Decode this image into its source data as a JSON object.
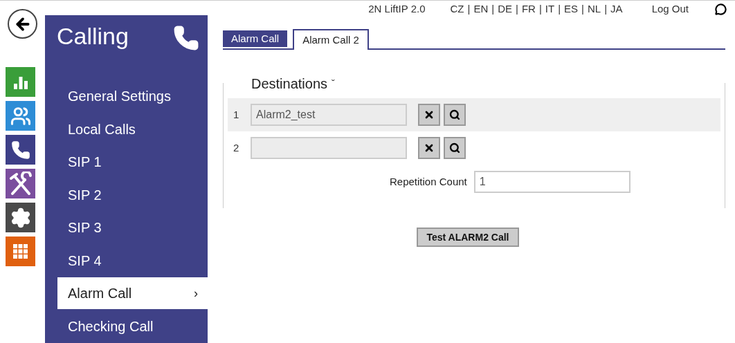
{
  "top_bar": {
    "device": "2N LiftIP 2.0",
    "languages": [
      "CZ",
      "EN",
      "DE",
      "FR",
      "IT",
      "ES",
      "NL",
      "JA"
    ],
    "separator": "|",
    "logout": "Log Out"
  },
  "app_icons": [
    {
      "kind": "chart",
      "color": "#3a9e3a"
    },
    {
      "kind": "users",
      "color": "#2d8dd6"
    },
    {
      "kind": "phone",
      "color": "#3d3f87"
    },
    {
      "kind": "tools",
      "color": "#7b4e9e"
    },
    {
      "kind": "gear",
      "color": "#4a4a4a"
    },
    {
      "kind": "grid",
      "color": "#e0600f"
    }
  ],
  "sidebar": {
    "title": "Calling",
    "items": [
      {
        "label": "General Settings",
        "selected": false
      },
      {
        "label": "Local Calls",
        "selected": false
      },
      {
        "label": "SIP 1",
        "selected": false
      },
      {
        "label": "SIP 2",
        "selected": false
      },
      {
        "label": "SIP 3",
        "selected": false
      },
      {
        "label": "SIP 4",
        "selected": false
      },
      {
        "label": "Alarm Call",
        "selected": true,
        "chevron": "›"
      },
      {
        "label": "Checking Call",
        "selected": false
      }
    ]
  },
  "tabs": [
    {
      "label": "Alarm Call",
      "selected": false
    },
    {
      "label": "Alarm Call 2",
      "selected": true
    }
  ],
  "destinations": {
    "title": "Destinations",
    "toggle": "ˇ",
    "rows": [
      {
        "index": "1",
        "value": "Alarm2_test",
        "highlighted": true
      },
      {
        "index": "2",
        "highlighted": false
      }
    ],
    "repetition_label": "Repetition Count",
    "repetition_value": "1"
  },
  "test_button": "Test ALARM2 Call"
}
